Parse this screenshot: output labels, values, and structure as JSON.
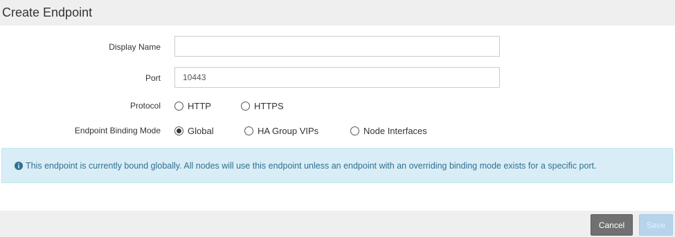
{
  "header": {
    "title": "Create Endpoint"
  },
  "form": {
    "display_name": {
      "label": "Display Name",
      "value": "",
      "placeholder": ""
    },
    "port": {
      "label": "Port",
      "value": "10443"
    },
    "protocol": {
      "label": "Protocol",
      "options": [
        {
          "label": "HTTP",
          "checked": false
        },
        {
          "label": "HTTPS",
          "checked": false
        }
      ]
    },
    "binding_mode": {
      "label": "Endpoint Binding Mode",
      "options": [
        {
          "label": "Global",
          "checked": true
        },
        {
          "label": "HA Group VIPs",
          "checked": false
        },
        {
          "label": "Node Interfaces",
          "checked": false
        }
      ]
    }
  },
  "alert": {
    "icon": "info-circle-icon",
    "text": "This endpoint is currently bound globally. All nodes will use this endpoint unless an endpoint with an overriding binding mode exists for a specific port."
  },
  "footer": {
    "cancel_label": "Cancel",
    "save_label": "Save"
  },
  "colors": {
    "alert_bg": "#d9edf7",
    "alert_text": "#31708f",
    "cancel_bg": "#717171",
    "save_bg_disabled": "#b7d4ec"
  }
}
